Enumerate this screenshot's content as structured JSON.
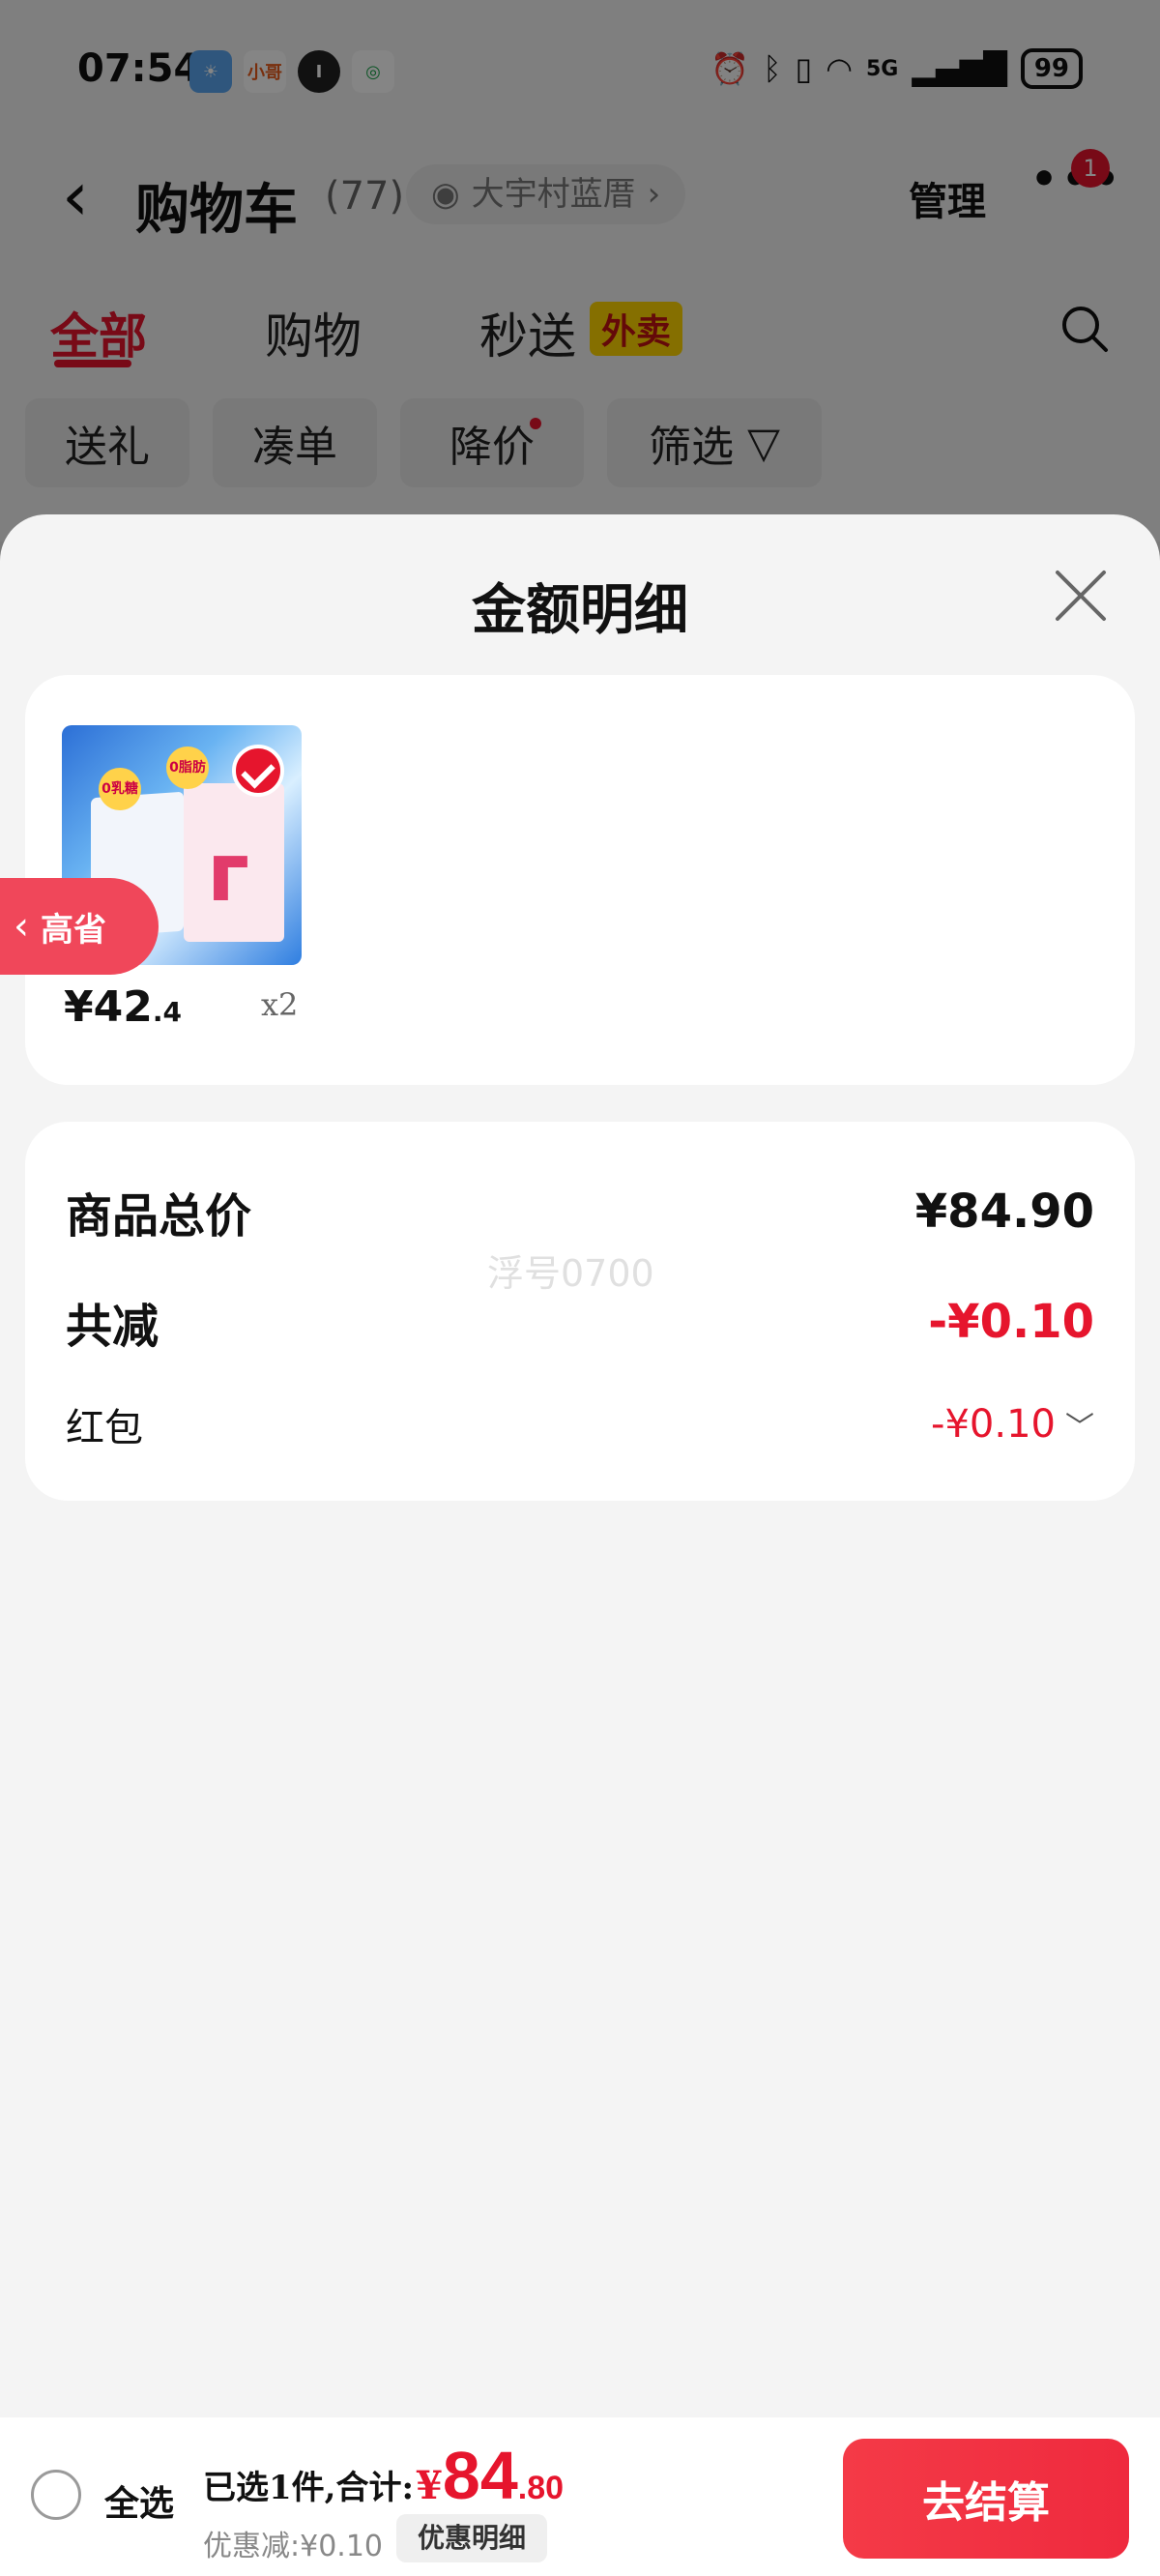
{
  "status_bar": {
    "time": "07:54",
    "battery": "99",
    "network": "5G",
    "apps": [
      "weather",
      "小哥",
      "I",
      "mobile"
    ]
  },
  "header": {
    "back_icon": "chevron-left-icon",
    "title": "购物车",
    "count": "(77)",
    "address": "大宇村蓝厝",
    "manage": "管理",
    "more_badge": "1"
  },
  "tabs": [
    {
      "label": "全部",
      "active": true
    },
    {
      "label": "购物"
    },
    {
      "label": "秒送"
    }
  ],
  "tab_badge": "外卖",
  "filters": [
    {
      "label": "送礼"
    },
    {
      "label": "凑单"
    },
    {
      "label": "降价",
      "dot": true
    },
    {
      "label": "筛选"
    }
  ],
  "sheet": {
    "title": "金额明细",
    "product": {
      "price_main": "¥42",
      "price_decimal": ".4",
      "quantity": "x2"
    },
    "save_tab": "高省",
    "summary": {
      "total_label": "商品总价",
      "total_value": "¥84.90",
      "reduce_label": "共减",
      "reduce_value": "-¥0.10",
      "redpacket_label": "红包",
      "redpacket_value": "-¥0.10",
      "watermark": "浮号0700"
    }
  },
  "footer": {
    "select_all": "全选",
    "selected_text": "已选1件,合计:",
    "currency": "¥",
    "total_int": "84",
    "total_dec": ".80",
    "discount_text": "优惠减:¥0.10",
    "discount_detail": "优惠明细",
    "checkout": "去结算"
  },
  "colors": {
    "accent": "#e6152d",
    "badge_yellow": "#ffd500"
  }
}
